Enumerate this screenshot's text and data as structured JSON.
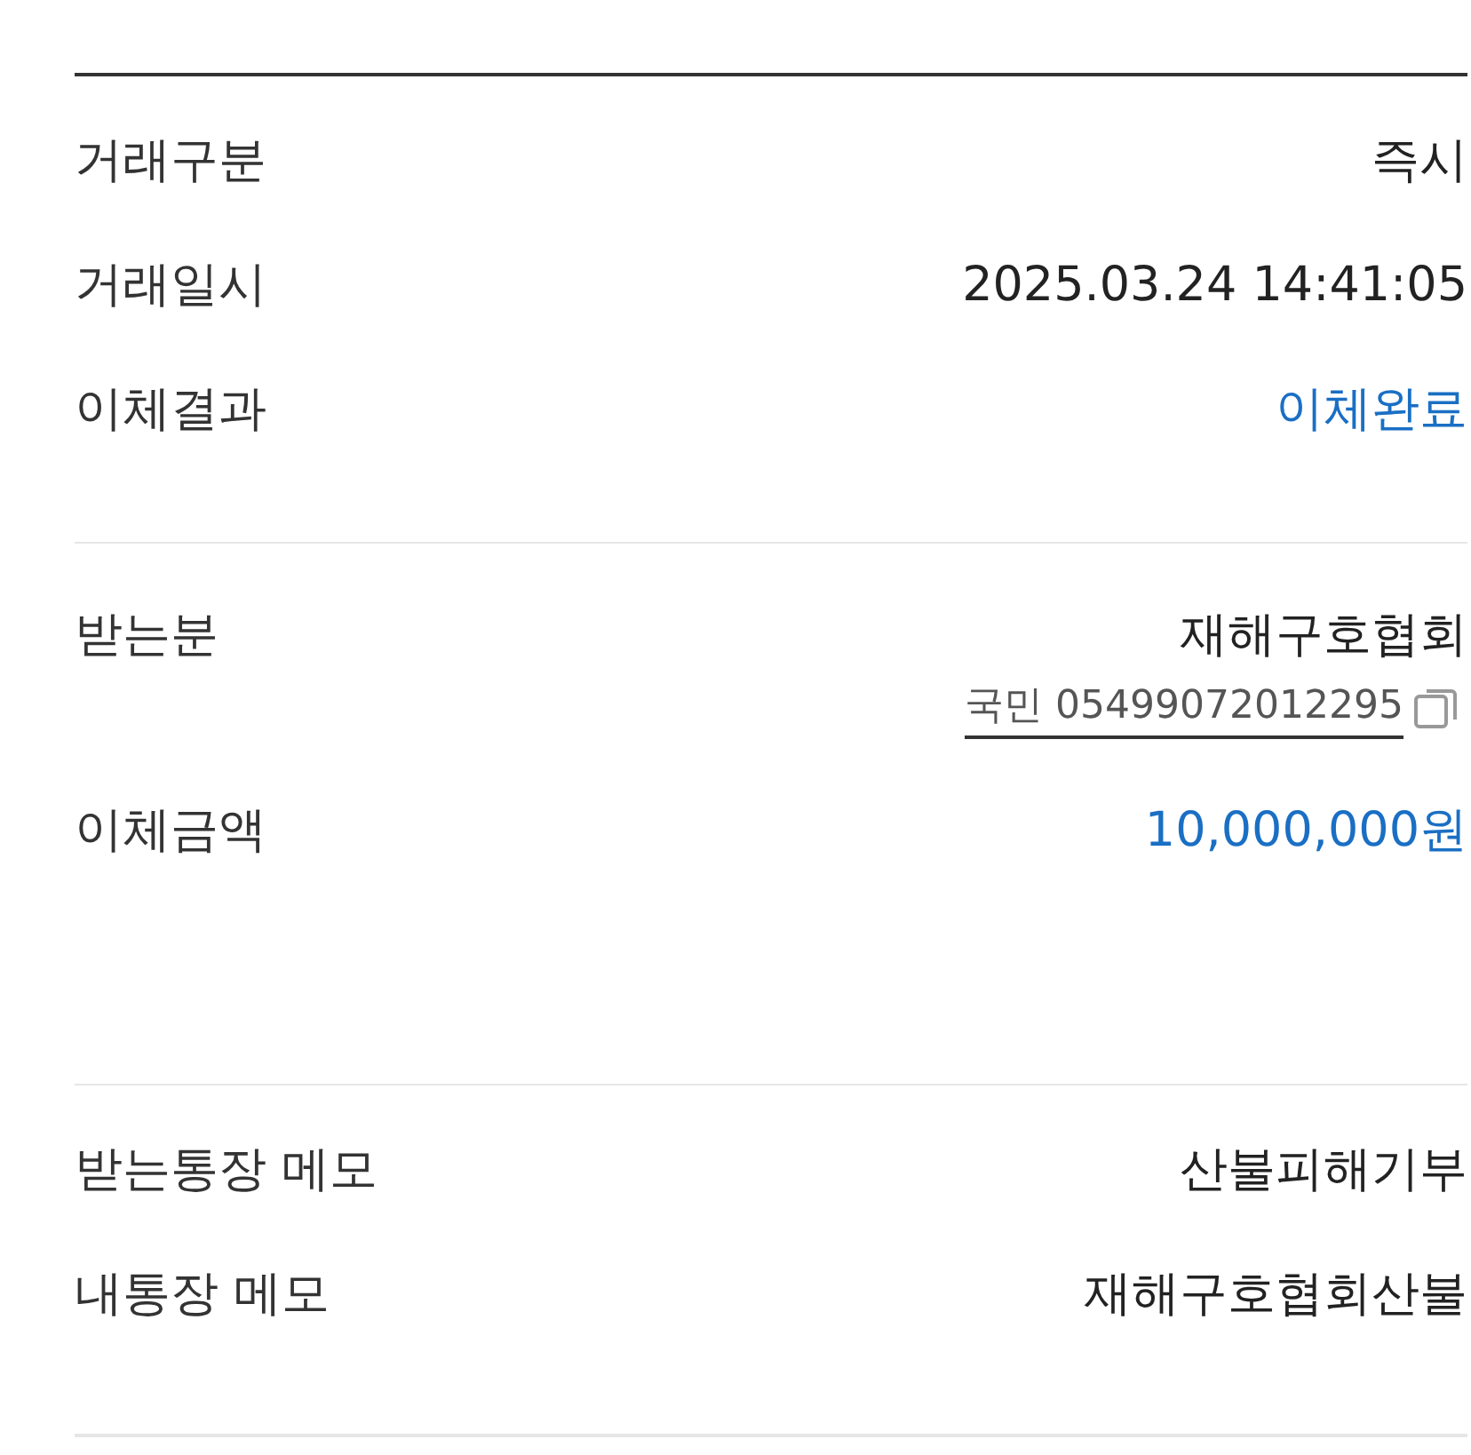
{
  "sections": [
    {
      "rows": [
        {
          "label": "거래구분",
          "value": "즉시",
          "kind": "plain"
        },
        {
          "label": "거래일시",
          "value": "2025.03.24 14:41:05",
          "kind": "plain"
        },
        {
          "label": "이체결과",
          "value": "이체완료",
          "kind": "accent"
        }
      ]
    },
    {
      "rows": [
        {
          "label": "받는분",
          "value": "재해구호협회",
          "kind": "plain",
          "account": "국민 05499072012295"
        },
        {
          "label": "이체금액",
          "value": "10,000,000원",
          "kind": "accent"
        }
      ]
    },
    {
      "rows": [
        {
          "label": "받는통장 메모",
          "value": "산불피해기부",
          "kind": "plain"
        },
        {
          "label": "내통장 메모",
          "value": "재해구호협회산불",
          "kind": "plain"
        }
      ]
    }
  ]
}
